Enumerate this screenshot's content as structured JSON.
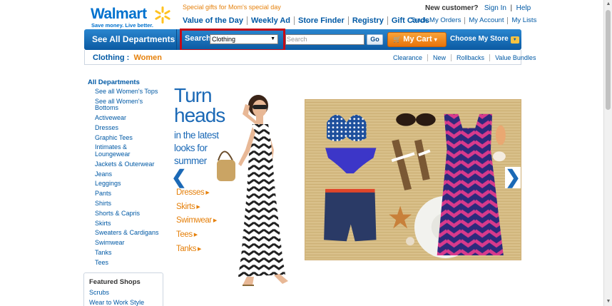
{
  "brand": {
    "name": "Walmart",
    "tagline": "Save money. Live better."
  },
  "promo_text": "Special gifts for Mom's special day",
  "top_nav": [
    "Value of the Day",
    "Weekly Ad",
    "Store Finder",
    "Registry",
    "Gift Cards"
  ],
  "new_customer": {
    "label": "New customer?",
    "sign_in": "Sign In",
    "help": "Help"
  },
  "account_links": [
    "Track My Orders",
    "My Account",
    "My Lists"
  ],
  "nav_bar": {
    "see_all": "See All Departments",
    "search_label": "Search",
    "category_value": "Clothing",
    "search_placeholder": "Search",
    "go": "Go",
    "cart": "My Cart",
    "store": "Choose My Store"
  },
  "breadcrumb": {
    "parent": "Clothing",
    "separator": ":",
    "current": "Women"
  },
  "sub_nav": [
    "Clearance",
    "New",
    "Rollbacks",
    "Value Bundles"
  ],
  "sidebar": {
    "title": "All Departments",
    "items": [
      "See all Women's Tops",
      "See all Women's Bottoms",
      "Activewear",
      "Dresses",
      "Graphic Tees",
      "Intimates & Loungewear",
      "Jackets & Outerwear",
      "Jeans",
      "Leggings",
      "Pants",
      "Shirts",
      "Shorts & Capris",
      "Skirts",
      "Sweaters & Cardigans",
      "Swimwear",
      "Tanks",
      "Tees"
    ]
  },
  "featured": {
    "title": "Featured Shops",
    "items": [
      "Scrubs",
      "Wear to Work Style"
    ]
  },
  "hero": {
    "headline_1": "Turn",
    "headline_2": "heads",
    "subline": "in the latest looks for summer",
    "links": [
      "Dresses",
      "Skirts",
      "Swimwear",
      "Tees",
      "Tanks"
    ]
  },
  "colors": {
    "brand_blue": "#0071ce",
    "accent_orange": "#e5800b",
    "highlight_red": "#c40a17"
  },
  "icons": {
    "spark": "spark-icon",
    "cart": "cart-icon",
    "dropdown": "chevron-down-icon",
    "prev": "chevron-left-icon",
    "next": "chevron-right-icon"
  }
}
